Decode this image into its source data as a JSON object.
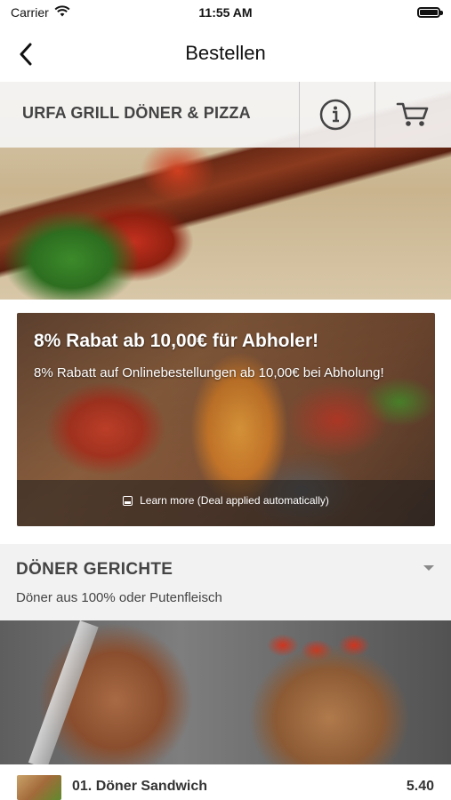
{
  "status_bar": {
    "carrier": "Carrier",
    "time": "11:55 AM"
  },
  "navbar": {
    "title": "Bestellen"
  },
  "restaurant": {
    "name": "URFA GRILL DÖNER & PIZZA"
  },
  "deal": {
    "headline": "8% Rabat ab 10,00€ für Abholer!",
    "description": "8% Rabatt auf Onlinebestellungen ab 10,00€ bei Abholung!",
    "learn_more": "Learn more (Deal applied automatically)"
  },
  "category": {
    "title": "DÖNER GERICHTE",
    "subtitle": "Döner aus 100% oder Putenfleisch"
  },
  "products": [
    {
      "name": "01. Döner Sandwich",
      "price": "5.40"
    }
  ]
}
